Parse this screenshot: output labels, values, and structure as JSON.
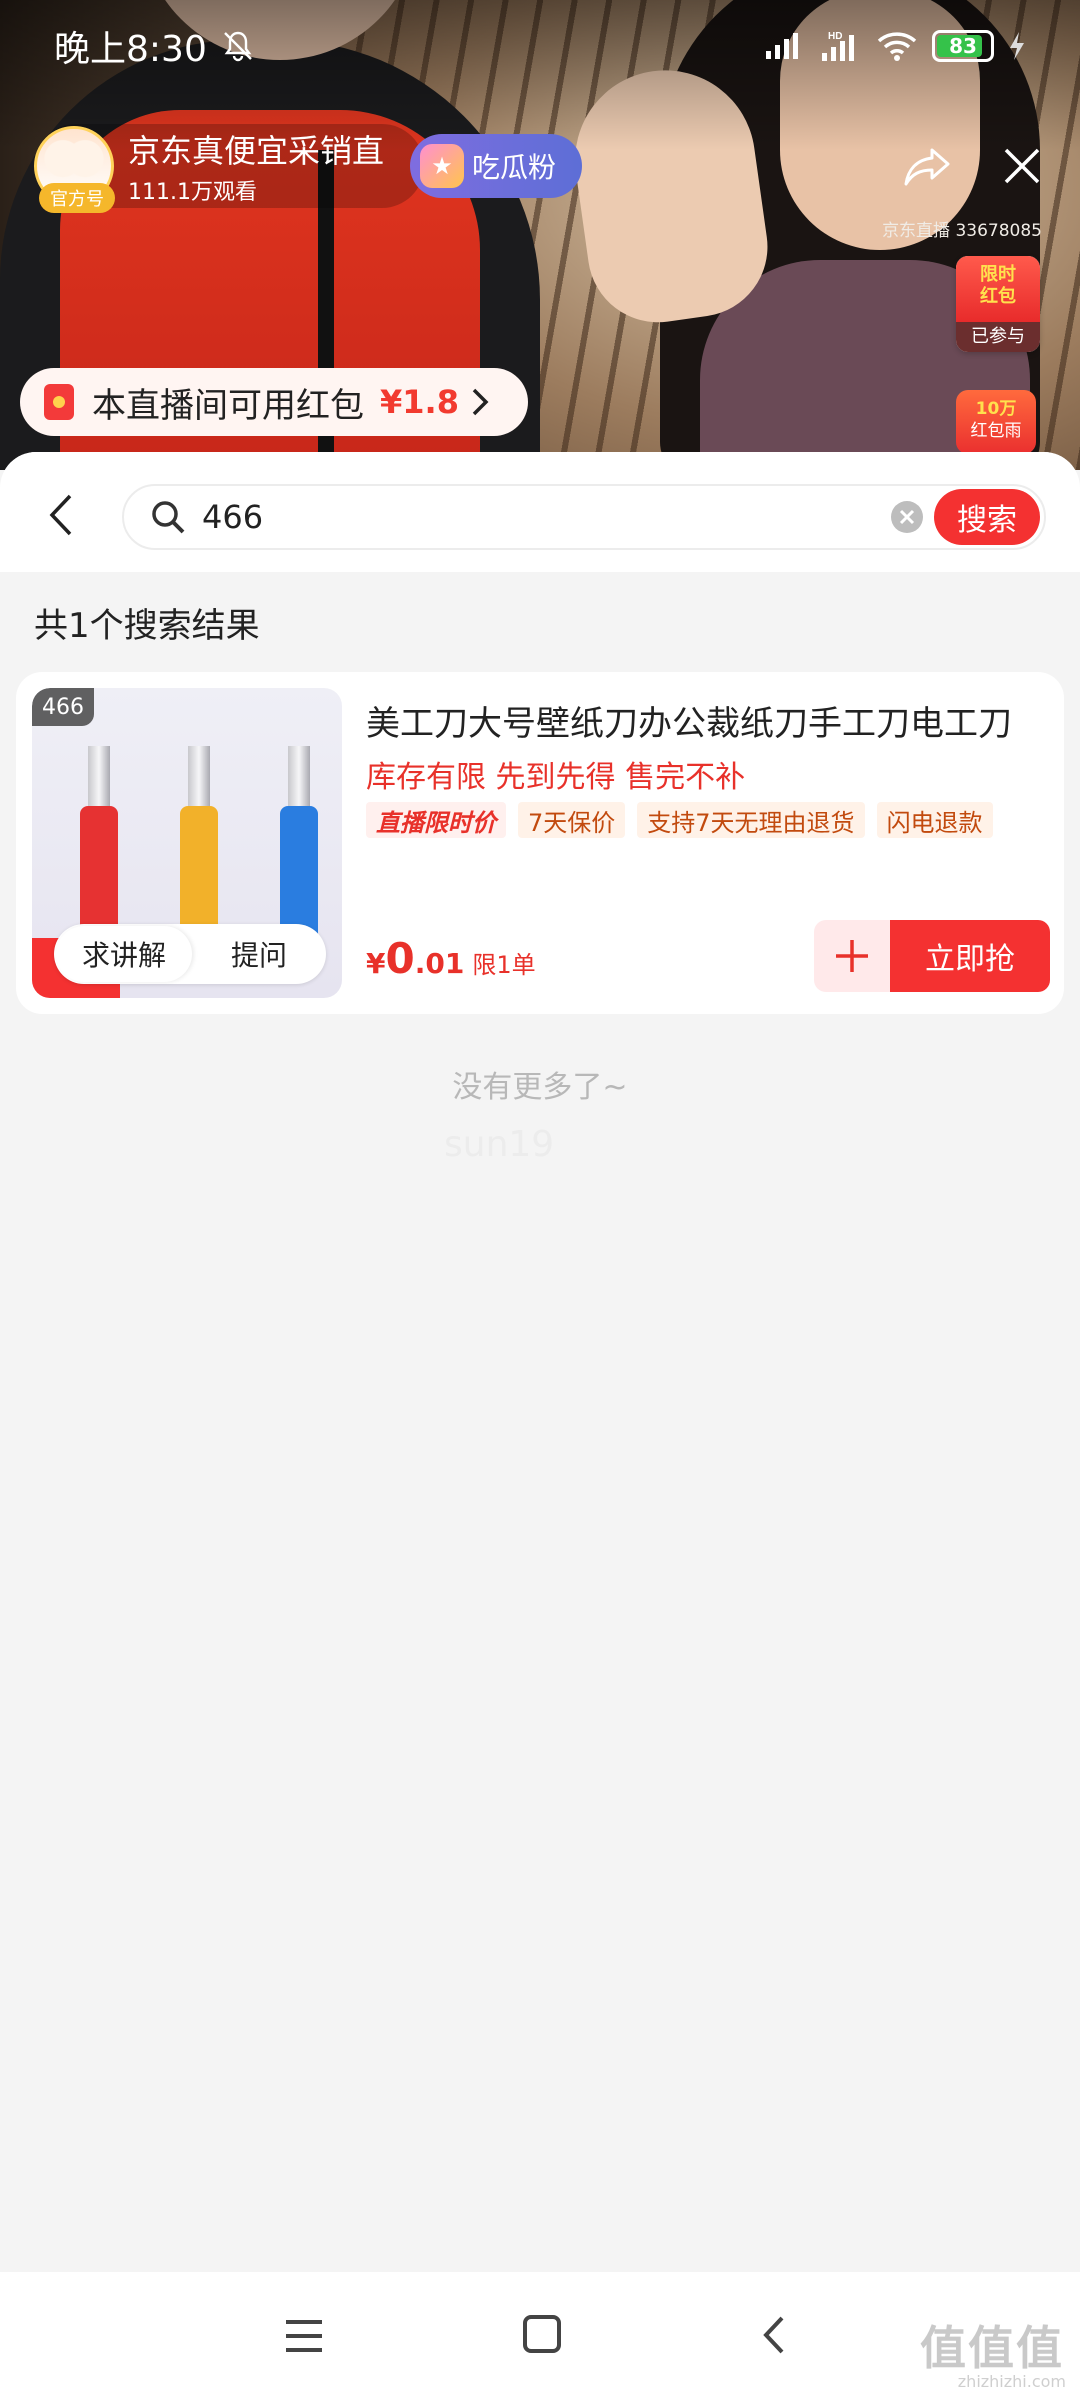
{
  "status_bar": {
    "time": "晚上8:30",
    "battery": "83",
    "network": "HD"
  },
  "streamer": {
    "name": "京东真便宜采销直",
    "badge": "官方号",
    "views": "111.1万观看",
    "fan_button": "吃瓜粉",
    "room_id": "京东直播 33678085"
  },
  "side_widgets": {
    "red_packet_title": "限时\n红包",
    "red_packet_status": "已参与",
    "rain_top": "10万",
    "rain_bottom": "红包雨"
  },
  "hongbao_banner": {
    "text": "本直播间可用红包",
    "amount": "¥1.8"
  },
  "search": {
    "value": "466",
    "button": "搜索"
  },
  "results": {
    "count_text": "共1个搜索结果",
    "items": [
      {
        "index_badge": "466",
        "title": "美工刀大号壁纸刀办公裁纸刀手工刀电工刀",
        "stock_text": "库存有限 先到先得 售完不补",
        "tags": [
          "直播限时价",
          "7天保价",
          "支持7天无理由退货",
          "闪电退款"
        ],
        "price_symbol": "¥",
        "price_int": "0",
        "price_dec": ".01",
        "limit": "限1单",
        "explain_label": "求讲解",
        "ask_label": "提问",
        "buy_label": "立即抢"
      }
    ],
    "end_text": "没有更多了~",
    "watermark_user": "sun19"
  },
  "site_mark": {
    "text": "值值值",
    "sub": "zhizhizhi.com"
  },
  "colors": {
    "accent": "#f43131",
    "price": "#e8312a",
    "background": "#f4f4f4"
  }
}
